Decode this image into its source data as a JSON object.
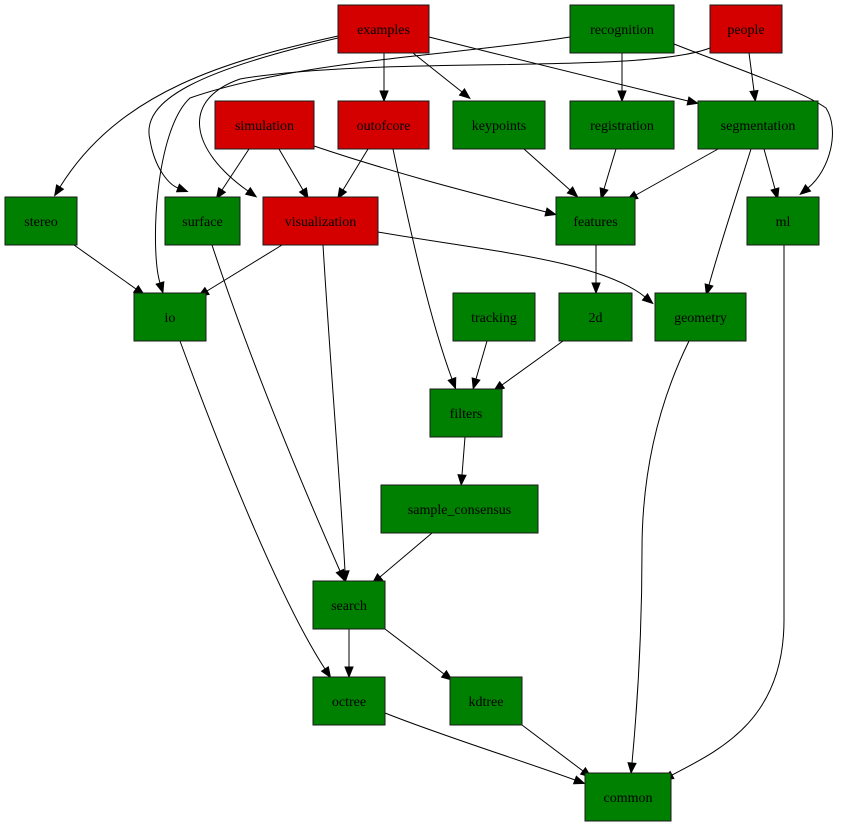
{
  "diagram": {
    "type": "directed-dependency-graph",
    "colors": {
      "highlighted": "#d40000",
      "default": "#008000",
      "edge": "#000000"
    },
    "nodes": [
      {
        "id": "examples",
        "label": "examples",
        "status": "highlighted"
      },
      {
        "id": "recognition",
        "label": "recognition",
        "status": "default"
      },
      {
        "id": "people",
        "label": "people",
        "status": "highlighted"
      },
      {
        "id": "simulation",
        "label": "simulation",
        "status": "highlighted"
      },
      {
        "id": "outofcore",
        "label": "outofcore",
        "status": "highlighted"
      },
      {
        "id": "keypoints",
        "label": "keypoints",
        "status": "default"
      },
      {
        "id": "registration",
        "label": "registration",
        "status": "default"
      },
      {
        "id": "segmentation",
        "label": "segmentation",
        "status": "default"
      },
      {
        "id": "stereo",
        "label": "stereo",
        "status": "default"
      },
      {
        "id": "surface",
        "label": "surface",
        "status": "default"
      },
      {
        "id": "visualization",
        "label": "visualization",
        "status": "highlighted"
      },
      {
        "id": "features",
        "label": "features",
        "status": "default"
      },
      {
        "id": "ml",
        "label": "ml",
        "status": "default"
      },
      {
        "id": "io",
        "label": "io",
        "status": "default"
      },
      {
        "id": "tracking",
        "label": "tracking",
        "status": "default"
      },
      {
        "id": "2d",
        "label": "2d",
        "status": "default"
      },
      {
        "id": "geometry",
        "label": "geometry",
        "status": "default"
      },
      {
        "id": "filters",
        "label": "filters",
        "status": "default"
      },
      {
        "id": "sample_consensus",
        "label": "sample_consensus",
        "status": "default"
      },
      {
        "id": "search",
        "label": "search",
        "status": "default"
      },
      {
        "id": "octree",
        "label": "octree",
        "status": "default"
      },
      {
        "id": "kdtree",
        "label": "kdtree",
        "status": "default"
      },
      {
        "id": "common",
        "label": "common",
        "status": "default"
      }
    ],
    "edges": [
      {
        "from": "examples",
        "to": "outofcore"
      },
      {
        "from": "examples",
        "to": "keypoints"
      },
      {
        "from": "examples",
        "to": "segmentation"
      },
      {
        "from": "examples",
        "to": "stereo"
      },
      {
        "from": "examples",
        "to": "surface"
      },
      {
        "from": "recognition",
        "to": "registration"
      },
      {
        "from": "recognition",
        "to": "ml"
      },
      {
        "from": "recognition",
        "to": "io"
      },
      {
        "from": "people",
        "to": "segmentation"
      },
      {
        "from": "people",
        "to": "visualization"
      },
      {
        "from": "simulation",
        "to": "surface"
      },
      {
        "from": "simulation",
        "to": "visualization"
      },
      {
        "from": "simulation",
        "to": "features"
      },
      {
        "from": "outofcore",
        "to": "visualization"
      },
      {
        "from": "outofcore",
        "to": "filters"
      },
      {
        "from": "keypoints",
        "to": "features"
      },
      {
        "from": "registration",
        "to": "features"
      },
      {
        "from": "segmentation",
        "to": "features"
      },
      {
        "from": "segmentation",
        "to": "ml"
      },
      {
        "from": "segmentation",
        "to": "geometry"
      },
      {
        "from": "stereo",
        "to": "io"
      },
      {
        "from": "surface",
        "to": "search"
      },
      {
        "from": "visualization",
        "to": "io"
      },
      {
        "from": "visualization",
        "to": "search"
      },
      {
        "from": "visualization",
        "to": "geometry"
      },
      {
        "from": "features",
        "to": "2d"
      },
      {
        "from": "ml",
        "to": "common"
      },
      {
        "from": "io",
        "to": "octree"
      },
      {
        "from": "tracking",
        "to": "filters"
      },
      {
        "from": "2d",
        "to": "filters"
      },
      {
        "from": "geometry",
        "to": "common"
      },
      {
        "from": "filters",
        "to": "sample_consensus"
      },
      {
        "from": "sample_consensus",
        "to": "search"
      },
      {
        "from": "search",
        "to": "octree"
      },
      {
        "from": "search",
        "to": "kdtree"
      },
      {
        "from": "octree",
        "to": "common"
      },
      {
        "from": "kdtree",
        "to": "common"
      }
    ]
  }
}
